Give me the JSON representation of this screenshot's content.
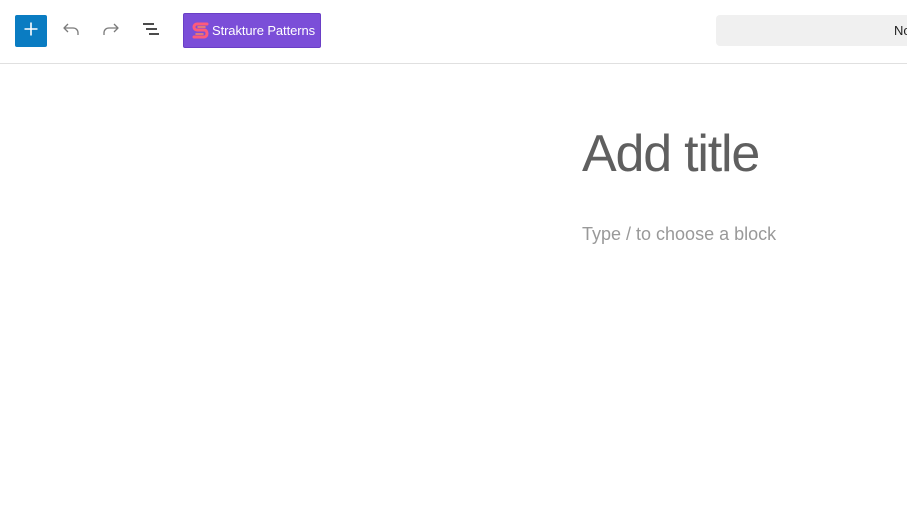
{
  "toolbar": {
    "add_block_icon": "plus-icon",
    "undo_icon": "undo-icon",
    "redo_icon": "redo-icon",
    "list_view_icon": "list-view-icon",
    "strakture_button": {
      "label": "Strakture Patterns",
      "logo": "strakture-s-logo",
      "color": "#7b4ed8"
    },
    "command_bar": {
      "visible_text": "No"
    },
    "accent_color": "#0a7cc2"
  },
  "editor": {
    "title_placeholder": "Add title",
    "block_placeholder": "Type / to choose a block"
  }
}
